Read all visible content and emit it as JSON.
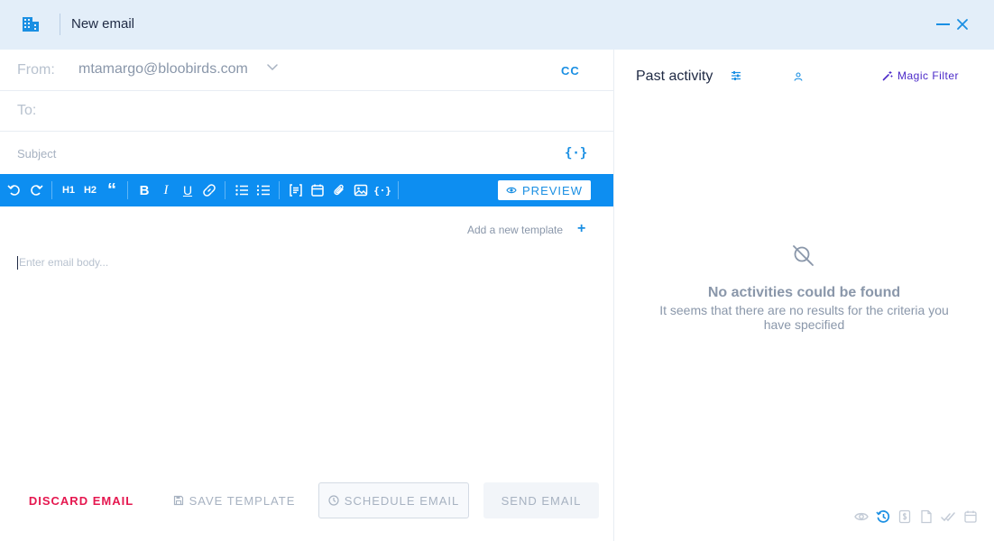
{
  "header": {
    "title": "New email"
  },
  "compose": {
    "from_label": "From:",
    "from_value": "mtamargo@bloobirds.com",
    "cc_label": "CC",
    "to_label": "To:",
    "subject_placeholder": "Subject",
    "variables_label": "{·}",
    "preview_label": "PREVIEW",
    "add_template_label": "Add a new template",
    "add_template_plus": "+",
    "body_placeholder": "Enter email body...",
    "toolbar": {
      "h1": "H1",
      "h2": "H2",
      "quote": "“",
      "bold": "B",
      "italic": "I",
      "underline": "U",
      "variables": "{·}"
    }
  },
  "footer": {
    "discard": "DISCARD EMAIL",
    "save_template": "SAVE TEMPLATE",
    "schedule": "SCHEDULE EMAIL",
    "send": "SEND EMAIL"
  },
  "activity": {
    "title": "Past activity",
    "magic_filter": "Magic Filter",
    "empty_title": "No activities could be found",
    "empty_subtitle": "It seems that there are no results for the criteria you have specified"
  },
  "colors": {
    "accent": "#1a8fe3",
    "toolbar": "#0d8ef1",
    "danger": "#e5174f",
    "magic": "#4a28c8",
    "header_bg": "#e3eef9"
  }
}
